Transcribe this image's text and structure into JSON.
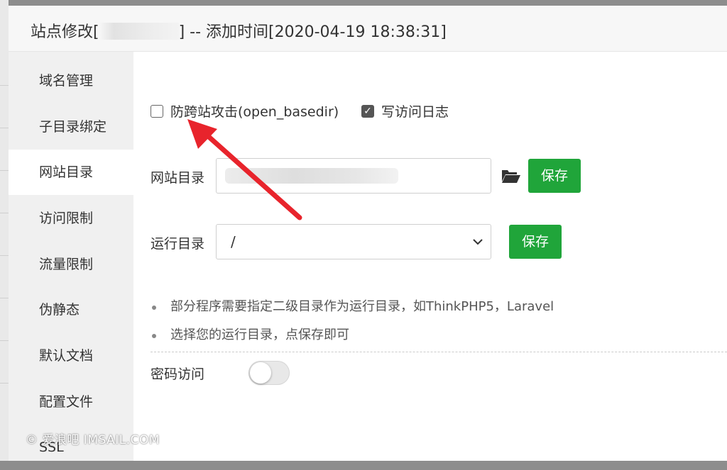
{
  "dialog": {
    "title_prefix": "站点修改[",
    "title_suffix": "] -- 添加时间[2020-04-19 18:38:31]"
  },
  "sidebar": {
    "items": [
      {
        "label": "域名管理"
      },
      {
        "label": "子目录绑定"
      },
      {
        "label": "网站目录",
        "active": true
      },
      {
        "label": "访问限制"
      },
      {
        "label": "流量限制"
      },
      {
        "label": "伪静态"
      },
      {
        "label": "默认文档"
      },
      {
        "label": "配置文件"
      },
      {
        "label": "SSL"
      }
    ]
  },
  "main": {
    "open_basedir": {
      "label": "防跨站攻击(open_basedir)",
      "checked": false
    },
    "access_log": {
      "label": "写访问日志",
      "checked": true
    },
    "site_dir": {
      "label": "网站目录",
      "save_label": "保存"
    },
    "run_dir": {
      "label": "运行目录",
      "value": "/",
      "save_label": "保存"
    },
    "tips": [
      "部分程序需要指定二级目录作为运行目录，如ThinkPHP5，Laravel",
      "选择您的运行目录，点保存即可"
    ],
    "password_access": {
      "label": "密码访问",
      "enabled": false
    }
  },
  "watermark": "© 爱浪吧 IMSAIL.COM",
  "colors": {
    "accent": "#20a53a",
    "annotation_arrow": "#e8242c"
  }
}
